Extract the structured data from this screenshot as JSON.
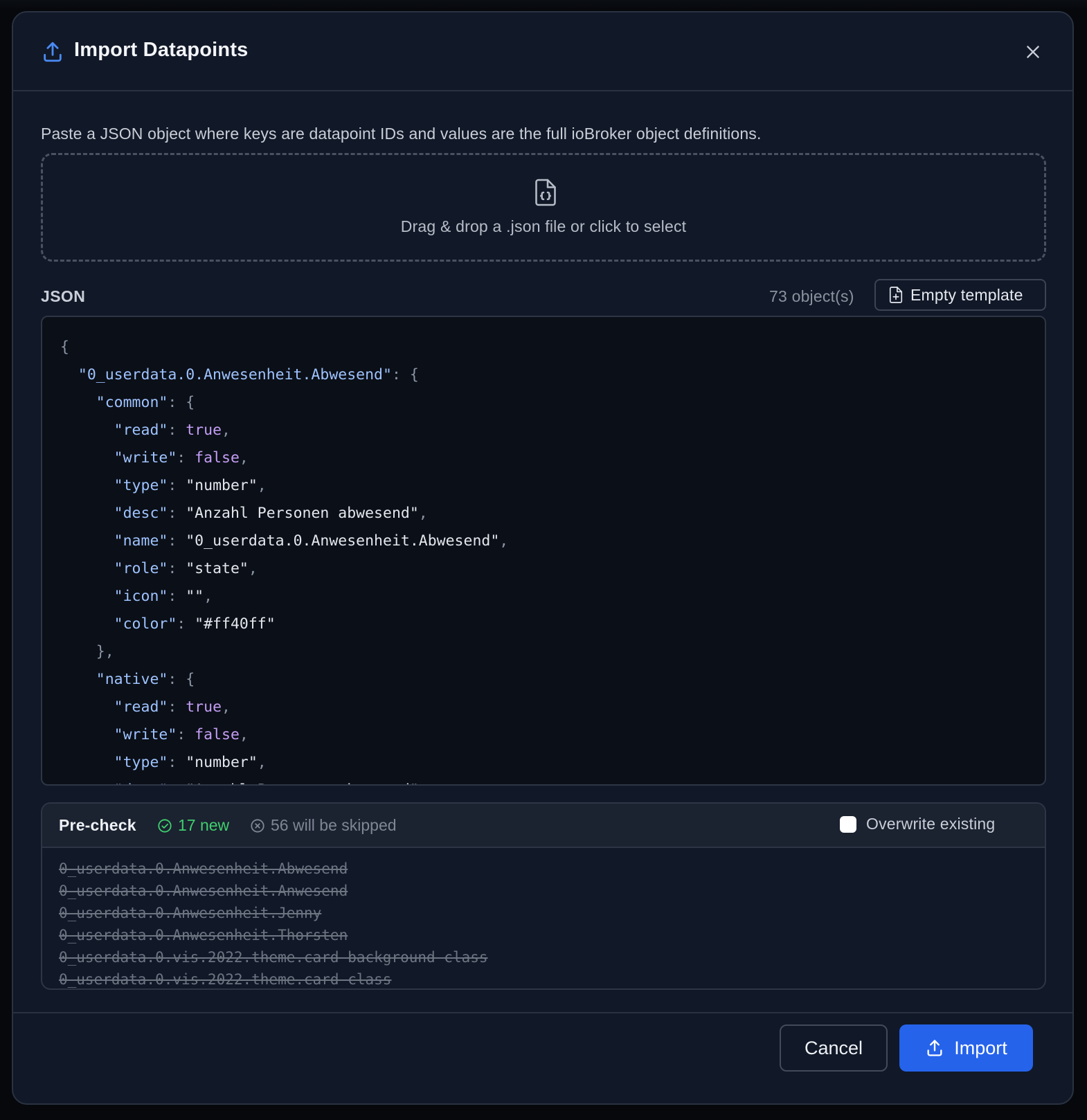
{
  "dialog": {
    "title": "Import Datapoints",
    "description": "Paste a JSON object where keys are datapoint IDs and values are the full ioBroker object definitions.",
    "header_icon": "upload-icon",
    "close_icon": "close-icon"
  },
  "dropzone": {
    "icon": "file-json-icon",
    "text": "Drag & drop a .json file or click to select"
  },
  "json_section": {
    "label": "JSON",
    "object_count": "73 object(s)",
    "template_button_label": "Empty template",
    "template_icon": "file-plus-icon"
  },
  "editor": {
    "lines": [
      [
        [
          "{",
          "p"
        ]
      ],
      [
        [
          "  ",
          "p"
        ],
        [
          "\"0_userdata.0.Anwesenheit.Abwesend\"",
          "k"
        ],
        [
          ": {",
          "p"
        ]
      ],
      [
        [
          "    ",
          "p"
        ],
        [
          "\"common\"",
          "k"
        ],
        [
          ": {",
          "p"
        ]
      ],
      [
        [
          "      ",
          "p"
        ],
        [
          "\"read\"",
          "k"
        ],
        [
          ": ",
          "p"
        ],
        [
          "true",
          "b"
        ],
        [
          ",",
          "p"
        ]
      ],
      [
        [
          "      ",
          "p"
        ],
        [
          "\"write\"",
          "k"
        ],
        [
          ": ",
          "p"
        ],
        [
          "false",
          "b"
        ],
        [
          ",",
          "p"
        ]
      ],
      [
        [
          "      ",
          "p"
        ],
        [
          "\"type\"",
          "k"
        ],
        [
          ": ",
          "p"
        ],
        [
          "\"number\"",
          "s"
        ],
        [
          ",",
          "p"
        ]
      ],
      [
        [
          "      ",
          "p"
        ],
        [
          "\"desc\"",
          "k"
        ],
        [
          ": ",
          "p"
        ],
        [
          "\"Anzahl Personen abwesend\"",
          "s"
        ],
        [
          ",",
          "p"
        ]
      ],
      [
        [
          "      ",
          "p"
        ],
        [
          "\"name\"",
          "k"
        ],
        [
          ": ",
          "p"
        ],
        [
          "\"0_userdata.0.Anwesenheit.Abwesend\"",
          "s"
        ],
        [
          ",",
          "p"
        ]
      ],
      [
        [
          "      ",
          "p"
        ],
        [
          "\"role\"",
          "k"
        ],
        [
          ": ",
          "p"
        ],
        [
          "\"state\"",
          "s"
        ],
        [
          ",",
          "p"
        ]
      ],
      [
        [
          "      ",
          "p"
        ],
        [
          "\"icon\"",
          "k"
        ],
        [
          ": ",
          "p"
        ],
        [
          "\"\"",
          "s"
        ],
        [
          ",",
          "p"
        ]
      ],
      [
        [
          "      ",
          "p"
        ],
        [
          "\"color\"",
          "k"
        ],
        [
          ": ",
          "p"
        ],
        [
          "\"#ff40ff\"",
          "s"
        ]
      ],
      [
        [
          "    },",
          "p"
        ]
      ],
      [
        [
          "    ",
          "p"
        ],
        [
          "\"native\"",
          "k"
        ],
        [
          ": {",
          "p"
        ]
      ],
      [
        [
          "      ",
          "p"
        ],
        [
          "\"read\"",
          "k"
        ],
        [
          ": ",
          "p"
        ],
        [
          "true",
          "b"
        ],
        [
          ",",
          "p"
        ]
      ],
      [
        [
          "      ",
          "p"
        ],
        [
          "\"write\"",
          "k"
        ],
        [
          ": ",
          "p"
        ],
        [
          "false",
          "b"
        ],
        [
          ",",
          "p"
        ]
      ],
      [
        [
          "      ",
          "p"
        ],
        [
          "\"type\"",
          "k"
        ],
        [
          ": ",
          "p"
        ],
        [
          "\"number\"",
          "s"
        ],
        [
          ",",
          "p"
        ]
      ],
      [
        [
          "      ",
          "p"
        ],
        [
          "\"desc\"",
          "k"
        ],
        [
          ": ",
          "p"
        ],
        [
          "\"Anzahl Personen abwesend\"",
          "s"
        ],
        [
          ",",
          "p"
        ]
      ]
    ]
  },
  "precheck": {
    "title": "Pre-check",
    "new_count": "17 new",
    "new_icon": "check-circle-icon",
    "skipped_count": "56 will be skipped",
    "skipped_icon": "x-circle-icon",
    "overwrite_label": "Overwrite existing",
    "skipped_items": [
      "0_userdata.0.Anwesenheit.Abwesend",
      "0_userdata.0.Anwesenheit.Anwesend",
      "0_userdata.0.Anwesenheit.Jenny",
      "0_userdata.0.Anwesenheit.Thorsten",
      "0_userdata.0.vis.2022.theme.card-background-class",
      "0_userdata.0.vis.2022.theme.card-class"
    ]
  },
  "footer": {
    "cancel_label": "Cancel",
    "import_label": "Import",
    "import_icon": "upload-icon"
  },
  "colors": {
    "accent": "#2563eb",
    "success": "#3fcf6e",
    "background": "#111827"
  }
}
